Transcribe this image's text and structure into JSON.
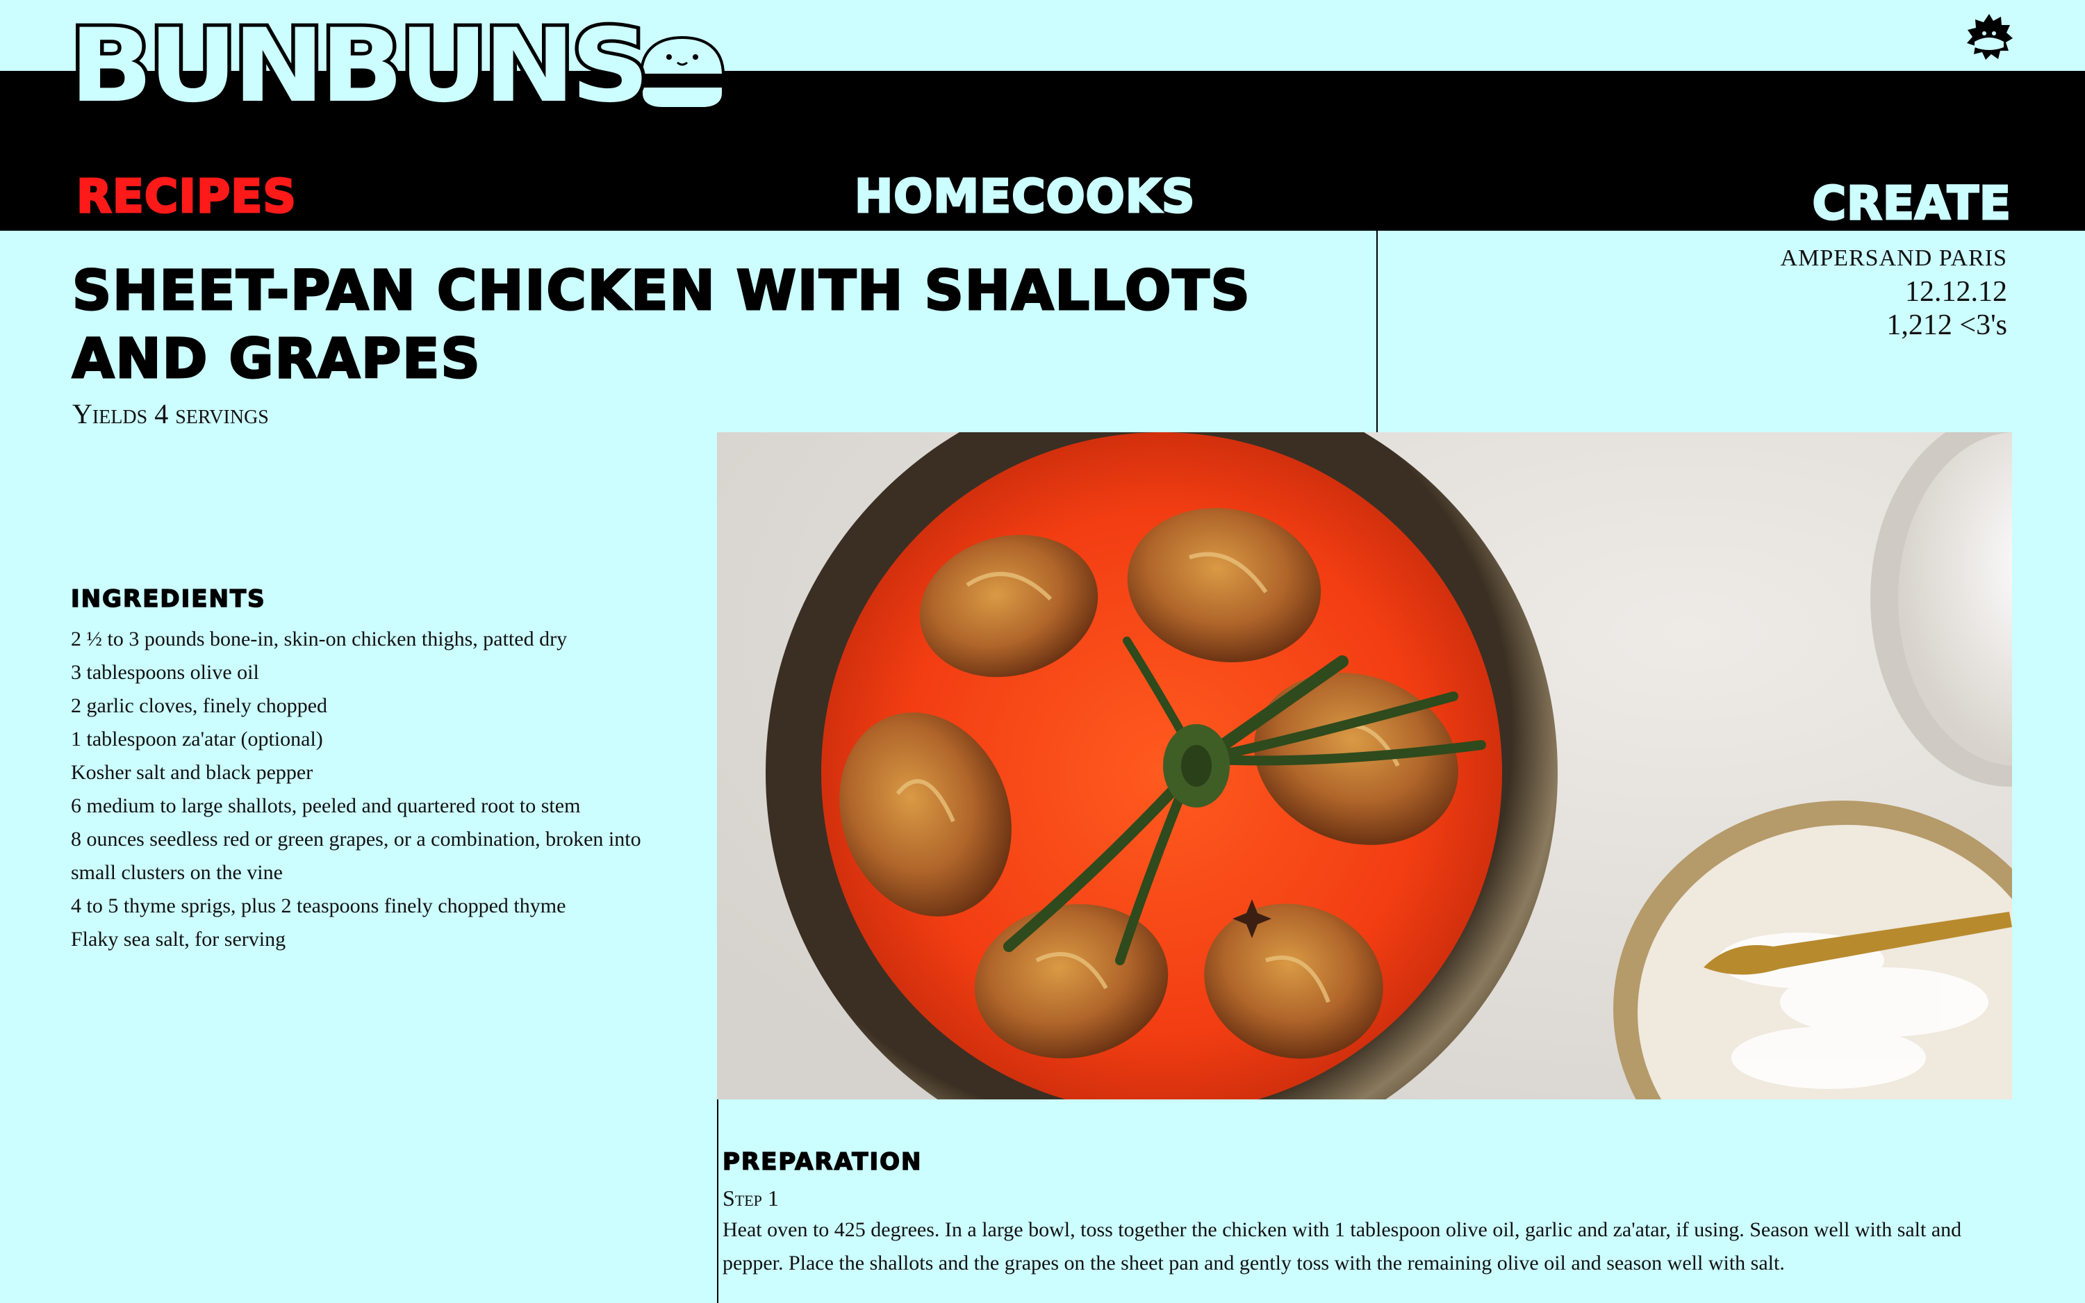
{
  "brand": {
    "logo_text": "BUNBUNS",
    "colors": {
      "background": "#ccfdff",
      "header_band": "#000000",
      "active_nav": "#ff1a1a"
    }
  },
  "header": {
    "menu_icon": "burst-badge-icon"
  },
  "nav": {
    "recipes": "RECIPES",
    "homecooks": "HOMECOOKS",
    "create": "CREATE",
    "active": "recipes"
  },
  "recipe": {
    "title": "SHEET-PAN CHICKEN WITH SHALLOTS AND GRAPES",
    "yields": "Yields 4 servings",
    "author": "AMPERSAND PARIS",
    "date": "12.12.12",
    "likes": "1,212 <3's",
    "ingredients_heading": "INGREDIENTS",
    "ingredients": [
      "2 ½ to 3 pounds bone-in, skin-on chicken thighs, patted dry",
      "3 tablespoons olive oil",
      "2 garlic cloves, finely chopped",
      "1 tablespoon za'atar (optional)",
      "Kosher salt and black pepper",
      "6 medium to large shallots, peeled and quartered root to stem",
      "8 ounces seedless red or green grapes, or a combination, broken into small clusters on the vine",
      "4 to 5 thyme sprigs, plus 2 teaspoons finely chopped thyme",
      "Flaky sea salt, for serving"
    ],
    "preparation_heading": "PREPARATION",
    "steps": [
      {
        "label": "Step 1",
        "text": "Heat oven to 425 degrees. In a large bowl, toss together the chicken with 1 tablespoon olive oil, garlic and za'atar, if using. Season well with salt and pepper. Place the shallots and the grapes on the sheet pan and gently toss with the remaining olive oil and season well with salt."
      }
    ]
  }
}
